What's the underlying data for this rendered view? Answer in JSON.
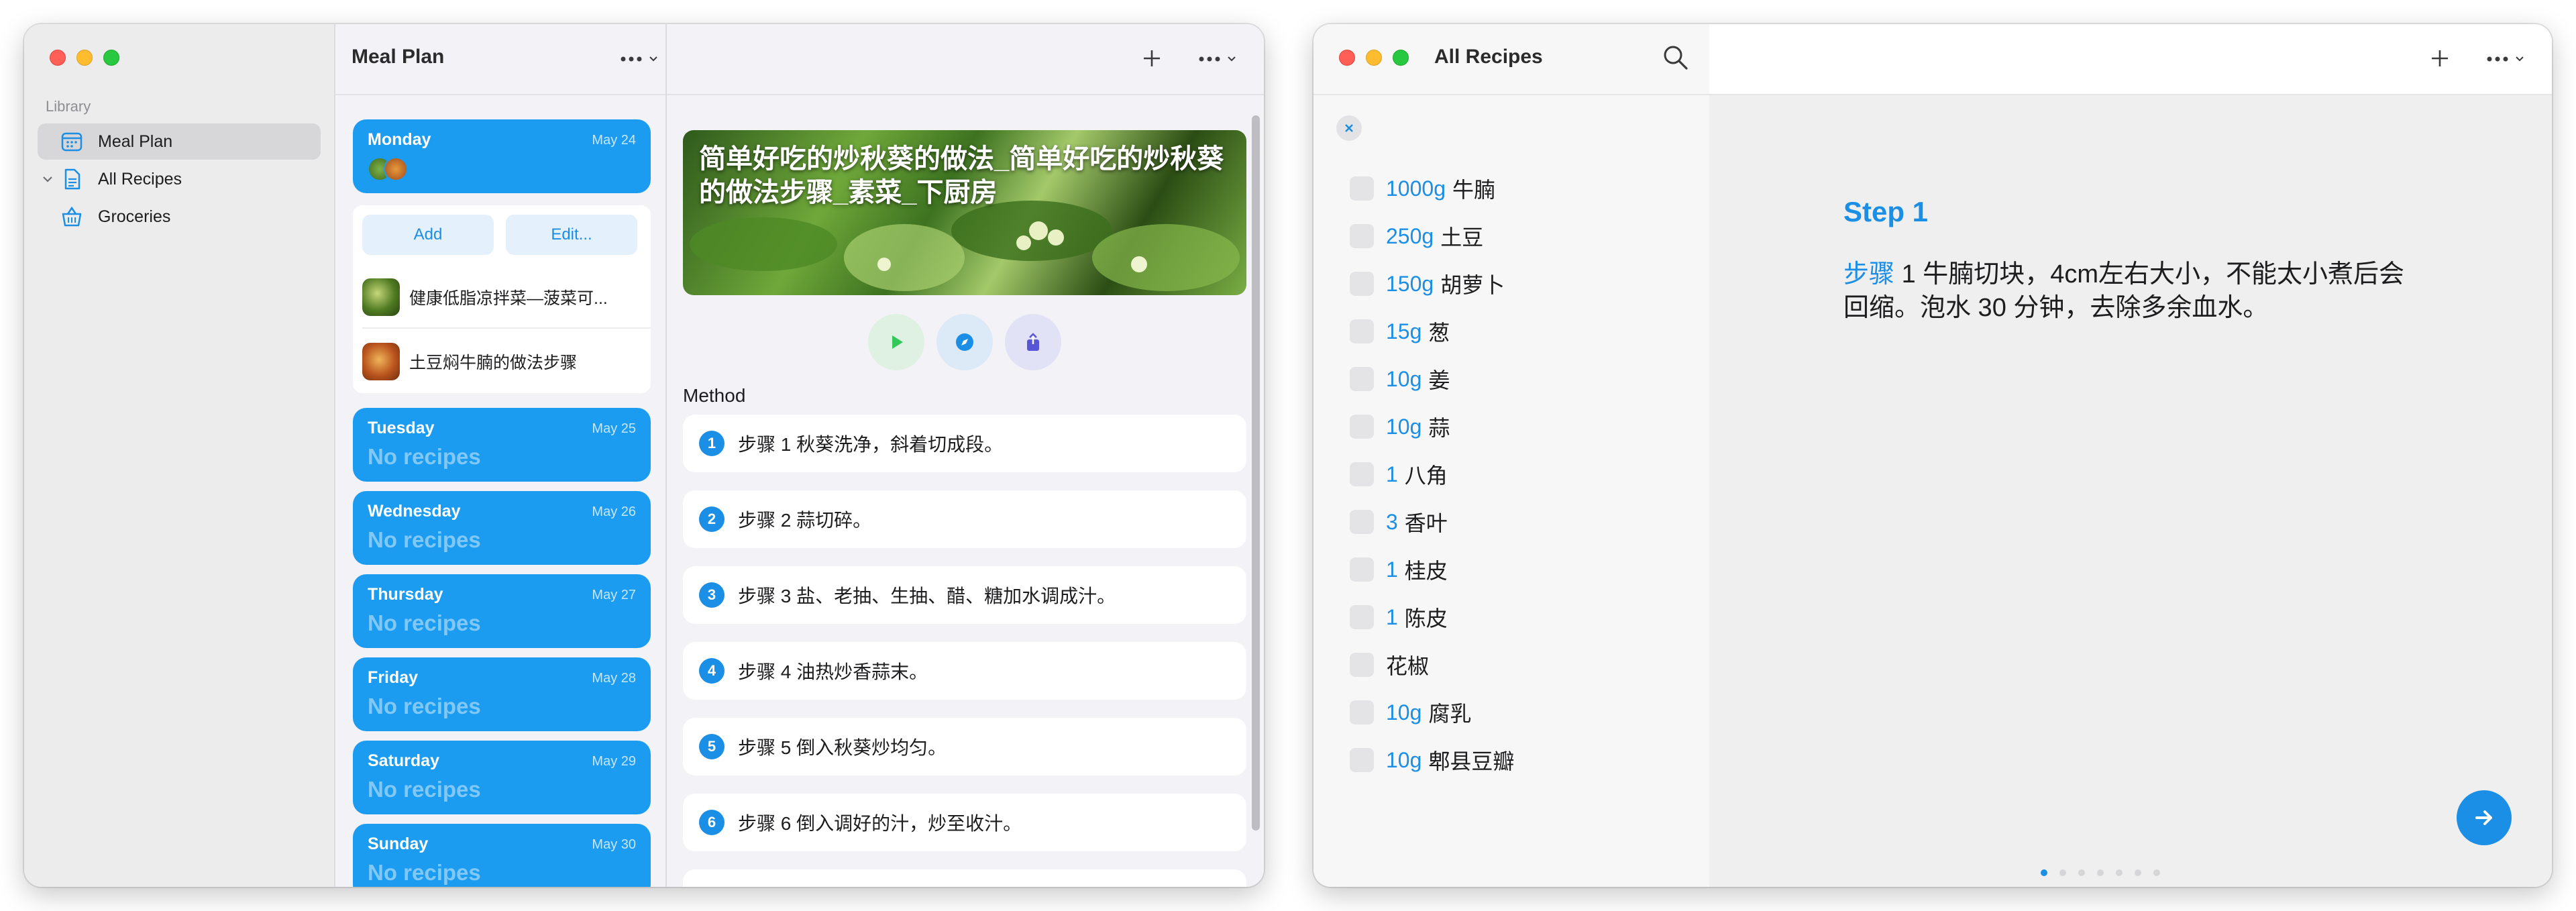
{
  "left_window": {
    "sidebar": {
      "section_label": "Library",
      "items": [
        {
          "label": "Meal Plan",
          "icon": "calendar-icon",
          "selected": true
        },
        {
          "label": "All Recipes",
          "icon": "document-icon",
          "selected": false
        },
        {
          "label": "Groceries",
          "icon": "basket-icon",
          "selected": false
        }
      ]
    },
    "plan": {
      "title": "Meal Plan",
      "days": [
        {
          "name": "Monday",
          "date": "May 24",
          "empty": ""
        },
        {
          "name": "Tuesday",
          "date": "May 25",
          "empty": "No recipes"
        },
        {
          "name": "Wednesday",
          "date": "May 26",
          "empty": "No recipes"
        },
        {
          "name": "Thursday",
          "date": "May 27",
          "empty": "No recipes"
        },
        {
          "name": "Friday",
          "date": "May 28",
          "empty": "No recipes"
        },
        {
          "name": "Saturday",
          "date": "May 29",
          "empty": "No recipes"
        },
        {
          "name": "Sunday",
          "date": "May 30",
          "empty": "No recipes"
        }
      ],
      "add_label": "Add",
      "edit_label": "Edit...",
      "recipes": [
        {
          "name": "健康低脂凉拌菜—菠菜可..."
        },
        {
          "name": "土豆焖牛腩的做法步骤"
        }
      ]
    },
    "detail": {
      "hero_title": "简单好吃的炒秋葵的做法_简单好吃的炒秋葵的做法步骤_素菜_下厨房",
      "method_label": "Method",
      "steps": [
        {
          "num": "1",
          "text": "步骤 1 秋葵洗净，斜着切成段。"
        },
        {
          "num": "2",
          "text": "步骤 2 蒜切碎。"
        },
        {
          "num": "3",
          "text": "步骤 3 盐、老抽、生抽、醋、糖加水调成汁。"
        },
        {
          "num": "4",
          "text": "步骤 4 油热炒香蒜末。"
        },
        {
          "num": "5",
          "text": "步骤 5 倒入秋葵炒均匀。"
        },
        {
          "num": "6",
          "text": "步骤 6 倒入调好的汁，炒至收汁。"
        }
      ]
    }
  },
  "right_window": {
    "title": "All Recipes",
    "ingredients": [
      {
        "qty": "1000g",
        "name": "牛腩"
      },
      {
        "qty": "250g",
        "name": "土豆"
      },
      {
        "qty": "150g",
        "name": "胡萝卜"
      },
      {
        "qty": "15g",
        "name": "葱"
      },
      {
        "qty": "10g",
        "name": "姜"
      },
      {
        "qty": "10g",
        "name": "蒜"
      },
      {
        "qty": "1",
        "name": "八角"
      },
      {
        "qty": "3",
        "name": "香叶"
      },
      {
        "qty": "1",
        "name": "桂皮"
      },
      {
        "qty": "1",
        "name": "陈皮"
      },
      {
        "qty": "",
        "name": "花椒"
      },
      {
        "qty": "10g",
        "name": "腐乳"
      },
      {
        "qty": "10g",
        "name": "郫县豆瓣"
      }
    ],
    "step": {
      "title": "Step 1",
      "keyword": "步骤",
      "text": " 1 牛腩切块，4cm左右大小，不能太小煮后会回缩。泡水 30 分钟，去除多余血水。"
    }
  },
  "colors": {
    "accent": "#1b8ee6",
    "day_card": "#1b9cf0",
    "sidebar_bg": "#ececec"
  }
}
